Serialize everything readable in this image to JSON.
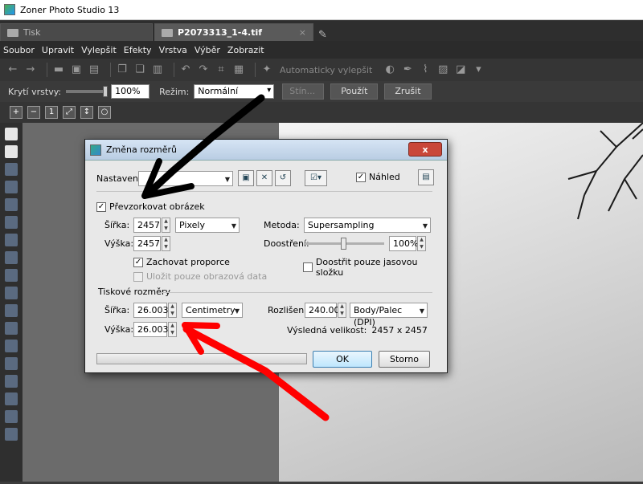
{
  "app": {
    "title": "Zoner Photo Studio 13"
  },
  "tabs": [
    {
      "label": "Tisk"
    },
    {
      "label": "P2073313_1-4.tif",
      "close": "×"
    }
  ],
  "menu": [
    "Soubor",
    "Upravit",
    "Vylepšit",
    "Efekty",
    "Vrstva",
    "Výběr",
    "Zobrazit"
  ],
  "toolbar": {
    "auto_enhance": "Automaticky vylepšit"
  },
  "options": {
    "opacity_label": "Krytí vrstvy:",
    "opacity_value": "100%",
    "mode_label": "Režim:",
    "mode_value": "Normální",
    "shadow_button": "Stín...",
    "apply_button": "Použít",
    "cancel_button": "Zrušit"
  },
  "dialog": {
    "title": "Změna rozměrů",
    "close": "x",
    "settings_label": "Nastavení:",
    "settings_value": "",
    "preview_label": "Náhled",
    "resample_label": "Převzorkovat obrázek",
    "width_label": "Šířka:",
    "width_value": "2457",
    "height_label": "Výška:",
    "height_value": "2457",
    "unit_px": "Pixely",
    "method_label": "Metoda:",
    "method_value": "Supersampling",
    "sharpen_label": "Doostření:",
    "sharpen_value": "100%",
    "sharpen_level": 0.5,
    "keep_ratio_label": "Zachovat proporce",
    "save_only_label": "Uložit pouze obrazová data",
    "sharpen_luma_label": "Doostřit pouze jasovou složku",
    "print_section_label": "Tiskové rozměry",
    "print_width_label": "Šířka:",
    "print_width_value": "26.003",
    "print_height_label": "Výška:",
    "print_height_value": "26.003",
    "print_unit": "Centimetry",
    "resolution_label": "Rozlišení:",
    "resolution_value": "240.000",
    "resolution_unit": "Body/Palec (DPI)",
    "result_size_label": "Výsledná velikost:",
    "result_size_value": "2457 x 2457",
    "ok_button": "OK",
    "cancel_button": "Storno"
  },
  "colors": {
    "arrow_black": "#000000",
    "arrow_red": "#ff0000",
    "close_red": "#c9473a"
  }
}
